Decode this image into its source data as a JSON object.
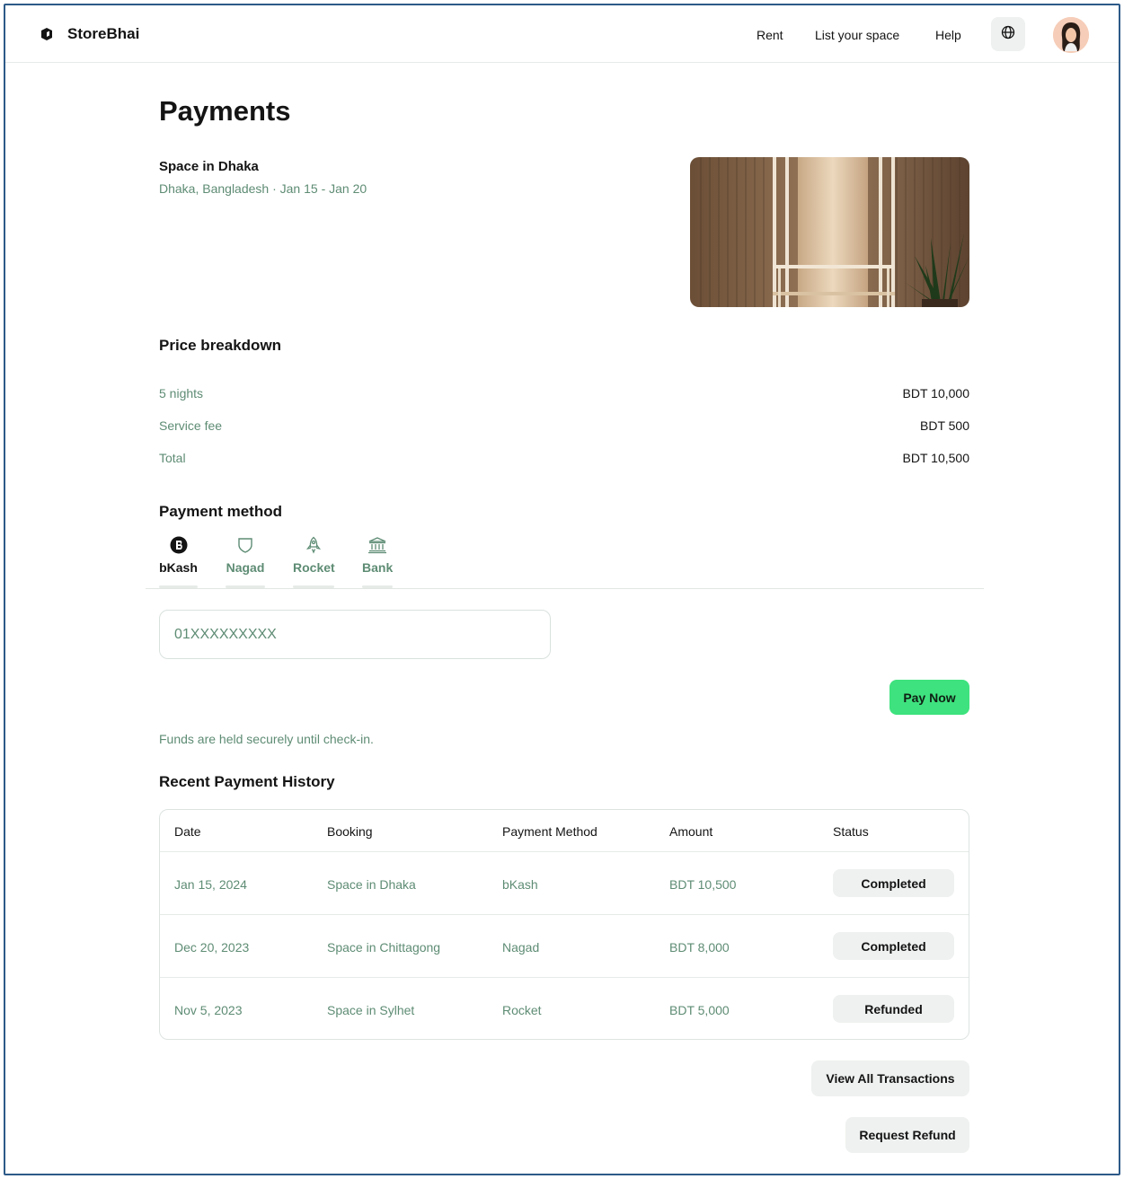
{
  "brand": {
    "name": "StoreBhai",
    "logo_icon": "cube-icon"
  },
  "nav": {
    "links": [
      "Rent",
      "List your space",
      "Help"
    ],
    "language_icon": "globe-icon"
  },
  "page": {
    "title": "Payments"
  },
  "listing": {
    "name": "Space in Dhaka",
    "meta": "Dhaka, Bangladesh · Jan 15 - Jan 20"
  },
  "price_breakdown": {
    "heading": "Price breakdown",
    "rows": [
      {
        "label": "5 nights",
        "value": "BDT 10,000"
      },
      {
        "label": "Service fee",
        "value": "BDT 500"
      },
      {
        "label": "Total",
        "value": "BDT 10,500"
      }
    ]
  },
  "payment_method": {
    "heading": "Payment method",
    "selected": "bKash",
    "methods": [
      {
        "label": "bKash",
        "icon": "bkash-icon"
      },
      {
        "label": "Nagad",
        "icon": "shield-icon"
      },
      {
        "label": "Rocket",
        "icon": "rocket-icon"
      },
      {
        "label": "Bank",
        "icon": "bank-icon"
      }
    ],
    "input_placeholder": "01XXXXXXXXX",
    "pay_label": "Pay Now",
    "secure_note": "Funds are held securely until check-in."
  },
  "history": {
    "heading": "Recent Payment History",
    "columns": [
      "Date",
      "Booking",
      "Payment Method",
      "Amount",
      "Status"
    ],
    "rows": [
      {
        "date": "Jan 15, 2024",
        "booking": "Space in Dhaka",
        "method": "bKash",
        "amount": "BDT 10,500",
        "status": "Completed"
      },
      {
        "date": "Dec 20, 2023",
        "booking": "Space in Chittagong",
        "method": "Nagad",
        "amount": "BDT 8,000",
        "status": "Completed"
      },
      {
        "date": "Nov 5, 2023",
        "booking": "Space in Sylhet",
        "method": "Rocket",
        "amount": "BDT 5,000",
        "status": "Refunded"
      }
    ],
    "view_all_label": "View All Transactions",
    "refund_label": "Request Refund"
  },
  "colors": {
    "accent": "#3ee27e",
    "muted_text": "#5e8c74",
    "frame_border": "#2d5a88",
    "pill_bg": "#eef1ef"
  }
}
